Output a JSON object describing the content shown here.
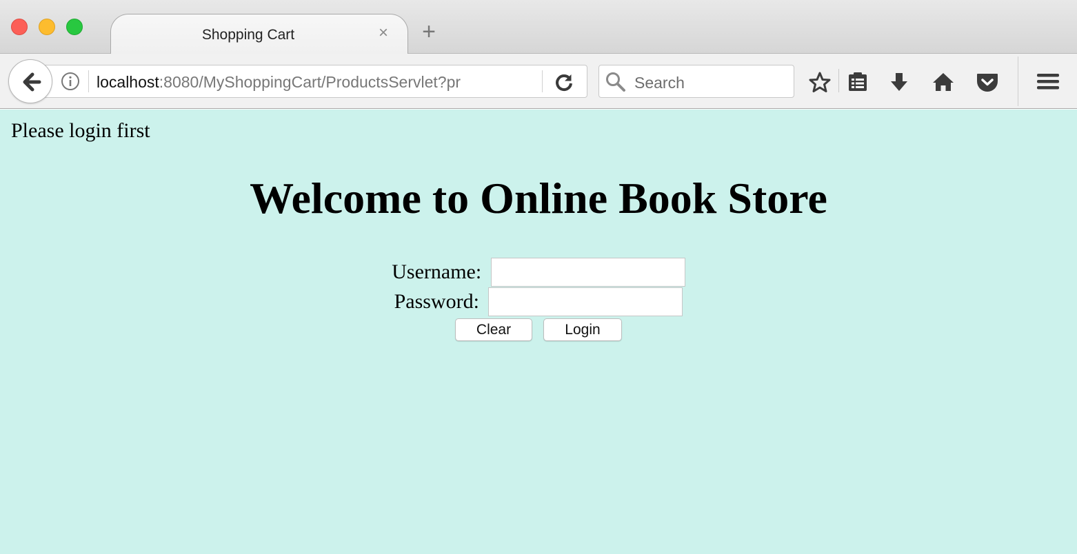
{
  "browser": {
    "tab": {
      "title": "Shopping Cart",
      "close_glyph": "×"
    },
    "new_tab_glyph": "+",
    "url": {
      "host": "localhost",
      "rest": ":8080/MyShoppingCart/ProductsServlet?pr"
    },
    "search": {
      "placeholder": "Search"
    },
    "icons": [
      "back-arrow-icon",
      "info-icon",
      "reload-icon",
      "search-icon",
      "bookmark-star-icon",
      "reading-list-icon",
      "download-icon",
      "home-icon",
      "pocket-icon",
      "hamburger-menu-icon"
    ]
  },
  "page": {
    "message": "Please login first",
    "heading": "Welcome to Online Book Store",
    "form": {
      "username_label": "Username:",
      "username_value": "",
      "password_label": "Password:",
      "password_value": "",
      "clear_label": "Clear",
      "login_label": "Login"
    },
    "background_color": "#ccf2ec"
  }
}
